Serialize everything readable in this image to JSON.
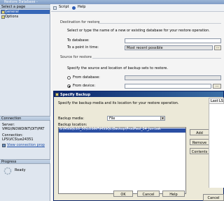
{
  "window": {
    "title": "Restore Database -"
  },
  "left": {
    "select_page": "Select a page",
    "pages": [
      {
        "label": "General"
      },
      {
        "label": "Options"
      }
    ],
    "connection_head": "Connection",
    "server_label": "Server:",
    "server_value": "VMG\\INOWDINT\\DIT\\PRT",
    "conn_label": "Connection:",
    "conn_value": "LPS\\VCS\\ue24351",
    "view_props": "View connection prop",
    "progress_head": "Progress",
    "ready": "Ready"
  },
  "toolbar": {
    "script": "Script",
    "help": "Help"
  },
  "restore": {
    "dest_label": "Destination for restore",
    "dest_desc": "Select or type the name of a new or existing database for your restore operation.",
    "to_db_label": "To database:",
    "point_label": "To a point in time:",
    "point_value": "Most recent possible",
    "source_label": "Source for restore",
    "source_desc": "Specify the source and location of backup sets to restore.",
    "from_db": "From database:",
    "from_device": "From device:",
    "last_lsn": "Last LS"
  },
  "dialog": {
    "title": "Specify Backup",
    "desc": "Specify the backup media and its location for your restore operation.",
    "media_label": "Backup media:",
    "media_value": "File",
    "location_label": "Backup location:",
    "location_value": "S:\\MSSQL10_50\\LOSINT\\MSSQL\\Backup\\",
    "location_suffix": "ProdPaul_24_Jun.bak",
    "add": "Add",
    "remove": "Remove",
    "contents": "Contents",
    "ok": "OK",
    "cancel": "Cancel",
    "help": "Help"
  },
  "bottom_buttons": {
    "cancel": "Cancel"
  }
}
